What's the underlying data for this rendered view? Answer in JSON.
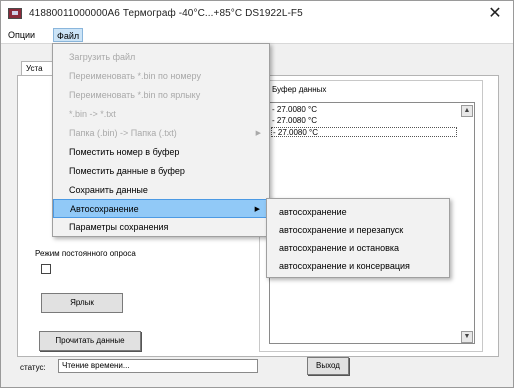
{
  "window": {
    "title": "41880011000000А6    Термограф -40°C...+85°C    DS1922L-F5",
    "close_glyph": "✕",
    "app_icon": "thermograph-app-icon"
  },
  "menubar": {
    "items": [
      {
        "label": "Опции"
      },
      {
        "label": "Файл"
      }
    ]
  },
  "tab": {
    "label": "Уста"
  },
  "buffer": {
    "label": "Буфер данных",
    "rows": [
      "- 27.0080 °C",
      "- 27.0080 °C",
      "- 27.0080 °C"
    ]
  },
  "mode": {
    "label": "Режим постоянного опроса"
  },
  "buttons": {
    "label_btn": "Ярлык",
    "read_btn": "Прочитать данные",
    "exit_btn": "Выход"
  },
  "status": {
    "label": "статус:",
    "value": "Чтение времени..."
  },
  "file_menu": {
    "items": [
      {
        "label": "Загрузить файл",
        "disabled": true
      },
      {
        "label": "Переименовать *.bin по номеру",
        "disabled": true
      },
      {
        "label": "Переименовать *.bin по ярлыку",
        "disabled": true
      },
      {
        "label": "*.bin -> *.txt",
        "disabled": true
      },
      {
        "label": "Папка (.bin) -> Папка (.txt)",
        "disabled": true,
        "submenu": true
      },
      {
        "label": "Поместить номер в буфер",
        "disabled": false
      },
      {
        "label": "Поместить данные в буфер",
        "disabled": false
      },
      {
        "label": "Сохранить данные",
        "disabled": false
      },
      {
        "label": "Автосохранение",
        "disabled": false,
        "submenu": true,
        "highlighted": true
      },
      {
        "label": "Параметры сохранения",
        "disabled": false
      }
    ]
  },
  "autosave_submenu": {
    "items": [
      {
        "label": "автосохранение"
      },
      {
        "label": "автосохранение и перезапуск"
      },
      {
        "label": "автосохранение и остановка"
      },
      {
        "label": "автосохранение и консервация"
      }
    ]
  }
}
